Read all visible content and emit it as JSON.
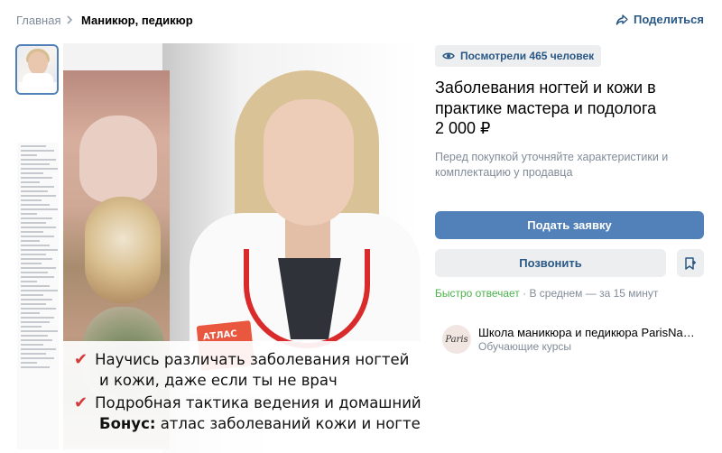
{
  "breadcrumb": {
    "home": "Главная",
    "current": "Маникюр, педикюр"
  },
  "header": {
    "share_label": "Поделиться"
  },
  "gallery": {
    "overlay_lines": [
      "Научись различать заболевания ногтей",
      "и кожи, даже если ты не врач",
      "Подробная тактика ведения и домашний уход",
      "Бонус:",
      " атлас заболеваний кожи и ногтей"
    ],
    "box_text": "АТЛАС"
  },
  "product": {
    "views": "Посмотрели 465 человек",
    "title": "Заболевания ногтей и кожи в практике мастера и подолога",
    "price": "2 000 ₽",
    "note": "Перед покупкой уточняйте характеристики и комплектацию у продавца"
  },
  "actions": {
    "apply_label": "Подать заявку",
    "call_label": "Позвонить"
  },
  "response": {
    "fast": "Быстро отвечает",
    "rest": " · В среднем — за 15 минут"
  },
  "seller": {
    "logo_text": "Paris",
    "name": "Школа маникюра и педикюра ParisNail ...",
    "category": "Обучающие курсы"
  },
  "colors": {
    "accent": "#5181b8",
    "link": "#2a5885",
    "muted": "#818c99",
    "green": "#4bb34b",
    "check": "#d33a3a"
  }
}
